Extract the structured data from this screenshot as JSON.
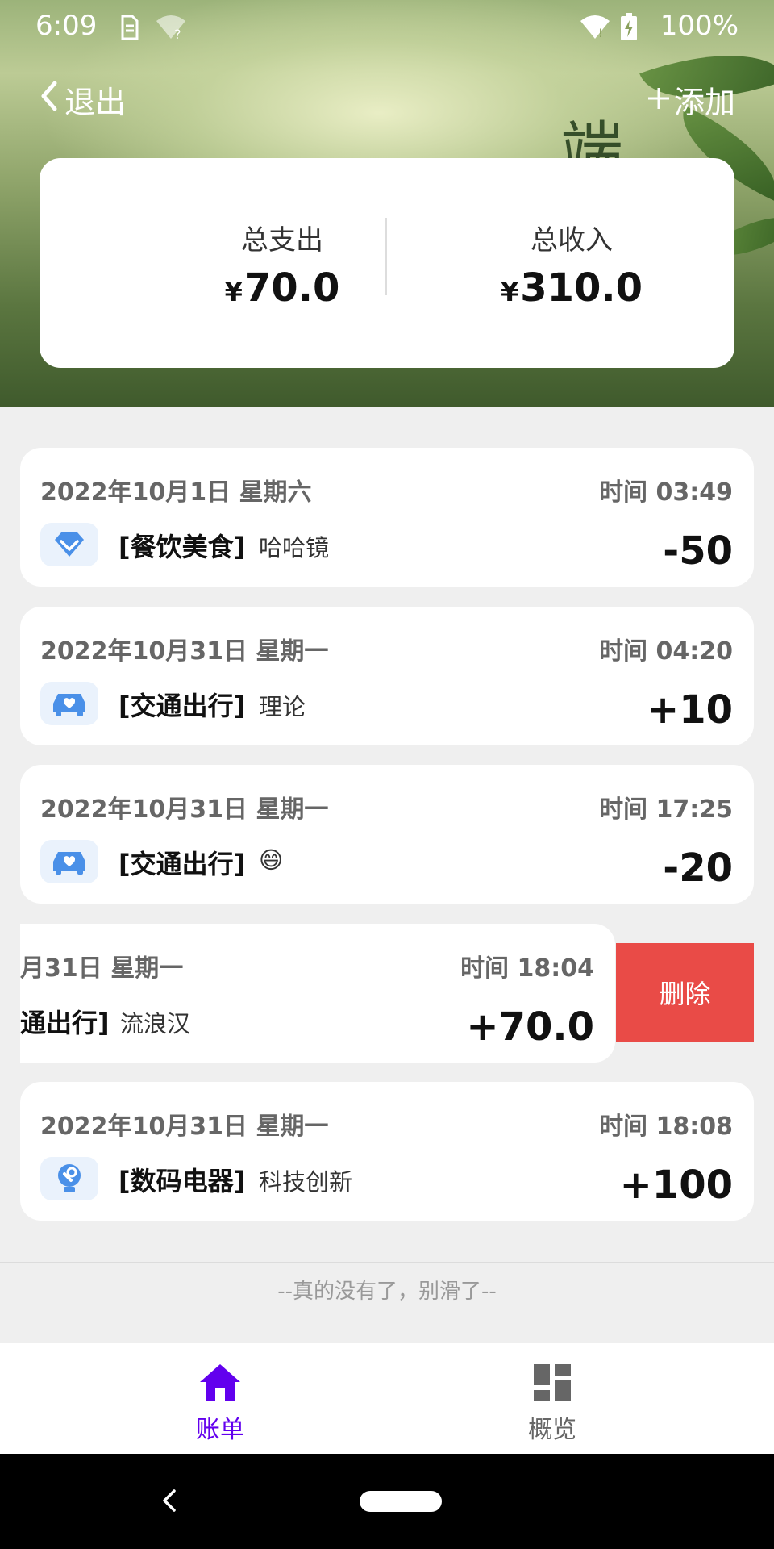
{
  "status_bar": {
    "time": "6:09",
    "battery": "100%",
    "icons": [
      "sim-icon",
      "wifi-question-icon",
      "wifi-icon",
      "battery-charging-icon"
    ]
  },
  "header": {
    "back_label": "退出",
    "add_label": "添加",
    "decor_char": "端"
  },
  "summary": {
    "expense_label": "总支出",
    "expense_currency": "¥",
    "expense_value": "70.0",
    "income_label": "总收入",
    "income_currency": "¥",
    "income_value": "310.0"
  },
  "records": [
    {
      "date": "2022年10月1日 星期六",
      "time": "时间 03:49",
      "category": "[餐饮美食]",
      "note": "哈哈镜",
      "amount": "-50",
      "icon": "diamond-icon"
    },
    {
      "date": "2022年10月31日 星期一",
      "time": "时间 04:20",
      "category": "[交通出行]",
      "note": "理论",
      "amount": "+10",
      "icon": "car-icon"
    },
    {
      "date": "2022年10月31日 星期一",
      "time": "时间 17:25",
      "category": "[交通出行]",
      "note": "😄",
      "amount": "-20",
      "icon": "car-icon"
    },
    {
      "date": "月31日 星期一",
      "time": "时间 18:04",
      "category": "通出行]",
      "note": "流浪汉",
      "amount": "+70.0",
      "icon": "car-icon"
    },
    {
      "date": "2022年10月31日 星期一",
      "time": "时间 18:08",
      "category": "[数码电器]",
      "note": "科技创新",
      "amount": "+100",
      "icon": "digital-icon"
    }
  ],
  "delete_label": "删除",
  "footer_text": "--真的没有了，别滑了--",
  "tabs": [
    {
      "label": "账单",
      "icon": "home-icon",
      "active": true
    },
    {
      "label": "概览",
      "icon": "dashboard-icon",
      "active": false
    }
  ],
  "colors": {
    "accent": "#6200ee",
    "inactive_tab": "#666666",
    "delete": "#e94b47",
    "icon_bg": "#eaf2fc",
    "icon_blue": "#4a90e8"
  }
}
